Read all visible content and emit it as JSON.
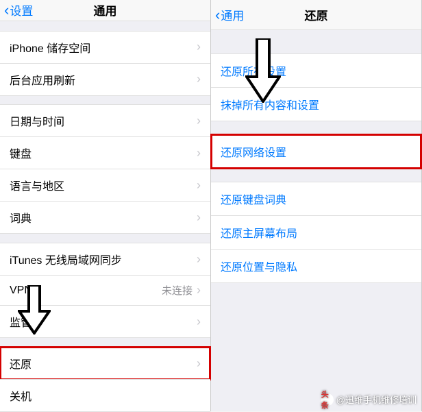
{
  "left": {
    "back": "设置",
    "title": "通用",
    "rows": {
      "storage": "iPhone 储存空间",
      "background_refresh": "后台应用刷新",
      "date_time": "日期与时间",
      "keyboard": "键盘",
      "lang_region": "语言与地区",
      "dict": "词典",
      "itunes_wifi": "iTunes 无线局域网同步",
      "vpn": "VPN",
      "vpn_value": "未连接",
      "monitor": "监管",
      "reset": "还原",
      "shutdown": "关机"
    }
  },
  "right": {
    "back": "通用",
    "title": "还原",
    "rows": {
      "reset_all": "还原所有设置",
      "erase_all": "抹掉所有内容和设置",
      "reset_network": "还原网络设置",
      "reset_keyboard": "还原键盘词典",
      "reset_home": "还原主屏幕布局",
      "reset_location": "还原位置与隐私"
    }
  },
  "watermark": {
    "prefix": "头条",
    "text": "@迅维手机维修培训"
  }
}
